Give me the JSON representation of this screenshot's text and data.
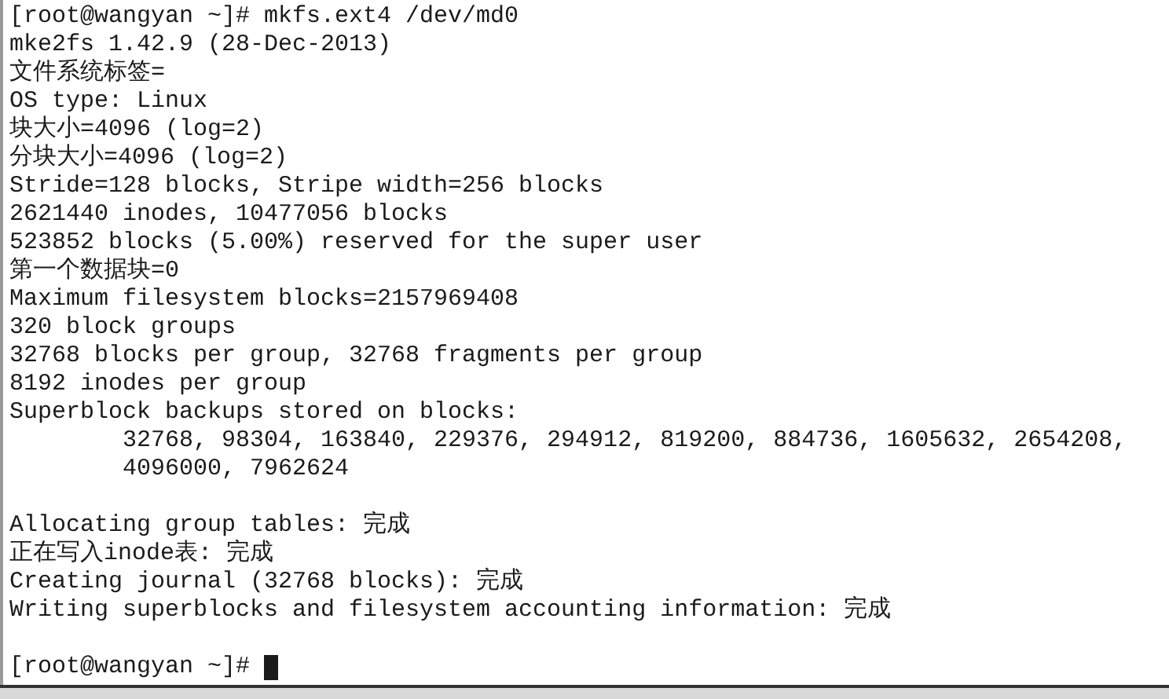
{
  "terminal": {
    "lines": [
      {
        "kind": "prompt",
        "prompt": "[root@wangyan ~]#",
        "command": "mkfs.ext4 /dev/md0"
      },
      {
        "kind": "output",
        "text": "mke2fs 1.42.9 (28-Dec-2013)"
      },
      {
        "kind": "output",
        "text": "文件系统标签="
      },
      {
        "kind": "output",
        "text": "OS type: Linux"
      },
      {
        "kind": "output",
        "text": "块大小=4096 (log=2)"
      },
      {
        "kind": "output",
        "text": "分块大小=4096 (log=2)"
      },
      {
        "kind": "output",
        "text": "Stride=128 blocks, Stripe width=256 blocks"
      },
      {
        "kind": "output",
        "text": "2621440 inodes, 10477056 blocks"
      },
      {
        "kind": "output",
        "text": "523852 blocks (5.00%) reserved for the super user"
      },
      {
        "kind": "output",
        "text": "第一个数据块=0"
      },
      {
        "kind": "output",
        "text": "Maximum filesystem blocks=2157969408"
      },
      {
        "kind": "output",
        "text": "320 block groups"
      },
      {
        "kind": "output",
        "text": "32768 blocks per group, 32768 fragments per group"
      },
      {
        "kind": "output",
        "text": "8192 inodes per group"
      },
      {
        "kind": "output",
        "text": "Superblock backups stored on blocks:"
      },
      {
        "kind": "output",
        "text": "        32768, 98304, 163840, 229376, 294912, 819200, 884736, 1605632, 2654208,"
      },
      {
        "kind": "output",
        "text": "        4096000, 7962624"
      },
      {
        "kind": "blank"
      },
      {
        "kind": "output",
        "text": "Allocating group tables: 完成"
      },
      {
        "kind": "output",
        "text": "正在写入inode表: 完成"
      },
      {
        "kind": "output",
        "text": "Creating journal (32768 blocks): 完成"
      },
      {
        "kind": "output",
        "text": "Writing superblocks and filesystem accounting information: 完成"
      },
      {
        "kind": "blank"
      },
      {
        "kind": "prompt",
        "prompt": "[root@wangyan ~]#",
        "cursor": true
      }
    ]
  }
}
